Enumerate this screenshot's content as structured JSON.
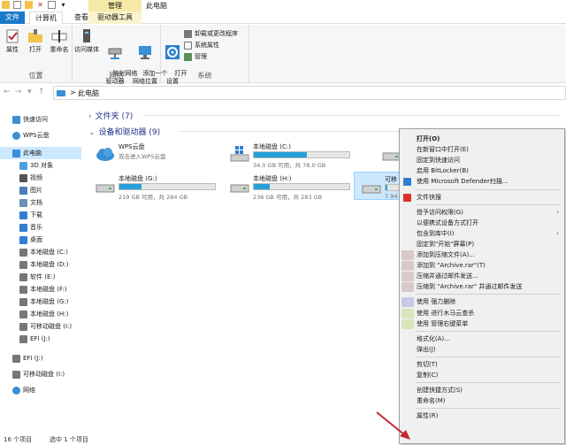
{
  "window": {
    "title": "此电脑",
    "context_group": "管理"
  },
  "tabs": {
    "file": "文件",
    "computer": "计算机",
    "view": "查看",
    "drive_tools": "驱动器工具"
  },
  "ribbon": {
    "location_group": {
      "title": "位置",
      "buttons": [
        "属性",
        "打开",
        "重命名"
      ]
    },
    "network_group": {
      "title": "网络",
      "buttons": [
        "访问媒体",
        "映射网络\n驱动器",
        "添加一个\n网络位置"
      ]
    },
    "system_group": {
      "title": "系统",
      "open_settings": "打开\n设置",
      "items": [
        "卸载或更改程序",
        "系统属性",
        "管理"
      ]
    }
  },
  "address": {
    "crumb": "此电脑",
    "separator": ">"
  },
  "nav_pane": {
    "items": [
      {
        "label": "快速访问",
        "icon": "star-icon",
        "color": "#3a8fd6"
      },
      {
        "label": "WPS云盘",
        "icon": "cloud-icon",
        "color": "#3a8fd6"
      },
      {
        "label": "此电脑",
        "icon": "computer-icon",
        "color": "#3a8fd6",
        "selected": true
      },
      {
        "label": "3D 对象",
        "icon": "cube-icon",
        "color": "#4aa0e0"
      },
      {
        "label": "视频",
        "icon": "video-icon",
        "color": "#555"
      },
      {
        "label": "图片",
        "icon": "picture-icon",
        "color": "#4b7fb8"
      },
      {
        "label": "文档",
        "icon": "document-icon",
        "color": "#6b8fb5"
      },
      {
        "label": "下载",
        "icon": "download-icon",
        "color": "#2f7fd1"
      },
      {
        "label": "音乐",
        "icon": "music-icon",
        "color": "#2f7fd1"
      },
      {
        "label": "桌面",
        "icon": "desktop-icon",
        "color": "#2f7fd1"
      },
      {
        "label": "本地磁盘 (C:)",
        "icon": "drive-icon",
        "color": "#777"
      },
      {
        "label": "本地磁盘 (D:)",
        "icon": "drive-icon",
        "color": "#777"
      },
      {
        "label": "软件 (E:)",
        "icon": "drive-icon",
        "color": "#777"
      },
      {
        "label": "本地磁盘 (F:)",
        "icon": "drive-icon",
        "color": "#777"
      },
      {
        "label": "本地磁盘 (G:)",
        "icon": "drive-icon",
        "color": "#777"
      },
      {
        "label": "本地磁盘 (H:)",
        "icon": "drive-icon",
        "color": "#777"
      },
      {
        "label": "可移动磁盘 (I:)",
        "icon": "usb-drive-icon",
        "color": "#777"
      },
      {
        "label": "EFI (J:)",
        "icon": "drive-icon",
        "color": "#777"
      },
      {
        "label": "EFI (J:)",
        "icon": "drive-icon",
        "color": "#777"
      },
      {
        "label": "可移动磁盘 (I:)",
        "icon": "usb-drive-icon",
        "color": "#777"
      },
      {
        "label": "网络",
        "icon": "network-icon",
        "color": "#3a8fd6"
      }
    ]
  },
  "content": {
    "folders_section": "文件夹 (7)",
    "devices_section": "设备和驱动器 (9)",
    "drives": [
      {
        "name": "WPS云盘",
        "sub": "双击进入WPS云盘",
        "fill": null,
        "icon": "wps-cloud-icon"
      },
      {
        "name": "本地磁盘 (C:)",
        "sub": "34.0 GB 可用，共 78.0 GB",
        "fill": 0.56,
        "icon": "windows-drive-icon"
      },
      {
        "name": "本",
        "sub": "46.7",
        "fill": 0.4,
        "icon": "drive-icon"
      },
      {
        "name": "本地磁盘 (G:)",
        "sub": "219 GB 可用，共 284 GB",
        "fill": 0.23,
        "icon": "drive-icon"
      },
      {
        "name": "本地磁盘 (H:)",
        "sub": "236 GB 可用，共 283 GB",
        "fill": 0.17,
        "icon": "drive-icon"
      },
      {
        "name": "可移",
        "sub": "7.94",
        "fill": 0.1,
        "icon": "usb-drive-icon"
      }
    ]
  },
  "status": {
    "count": "16 个项目",
    "selected": "选中 1 个项目"
  },
  "context_menu": {
    "items": [
      {
        "label": "打开(O)",
        "bold": true
      },
      {
        "label": "在新窗口中打开(E)"
      },
      {
        "label": "固定到快速访问"
      },
      {
        "label": "启用 BitLocker(B)"
      },
      {
        "label": "使用 Microsoft Defender扫描...",
        "icon": "defender-icon"
      },
      {
        "sep": true
      },
      {
        "label": "文件快搜",
        "icon": "wps-icon"
      },
      {
        "sep": true
      },
      {
        "label": "授予访问权限(G)",
        "submenu": true
      },
      {
        "label": "以便携式设备方式打开"
      },
      {
        "label": "包含到库中(I)",
        "submenu": true
      },
      {
        "label": "固定到\"开始\"屏幕(P)"
      },
      {
        "label": "添加到压缩文件(A)...",
        "blur": "#d9c9c9"
      },
      {
        "label": "添加到 \"Archive.rar\"(T)",
        "blur": "#d9c9c9"
      },
      {
        "label": "压缩并通过邮件发送...",
        "blur": "#d9c9c9"
      },
      {
        "label": "压缩到 \"Archive.rar\" 并通过邮件发送",
        "blur": "#d9c9c9"
      },
      {
        "sep": true
      },
      {
        "label": "使用          强力删除",
        "blur": "#c9c9e6"
      },
      {
        "label": "使用          进行木马云查杀",
        "blur": "#d6e6b8"
      },
      {
        "label": "使用          管理右键菜单",
        "blur": "#d6e6b8"
      },
      {
        "sep": true
      },
      {
        "label": "格式化(A)..."
      },
      {
        "label": "弹出(J)"
      },
      {
        "sep": true
      },
      {
        "label": "剪切(T)"
      },
      {
        "label": "复制(C)"
      },
      {
        "sep": true
      },
      {
        "label": "创建快捷方式(S)"
      },
      {
        "label": "重命名(M)"
      },
      {
        "sep": true
      },
      {
        "label": "属性(R)"
      }
    ]
  },
  "colors": {
    "accent": "#1979ca",
    "selection": "#cce8ff",
    "drive_fill": "#26a0da",
    "annotation_arrow": "#c0282d"
  }
}
